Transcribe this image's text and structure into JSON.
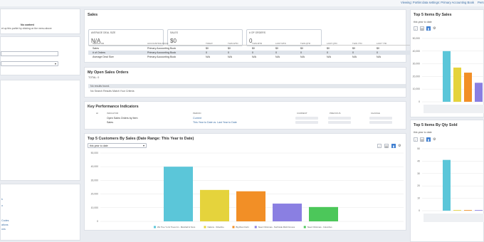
{
  "topbar": {
    "viewing": "Viewing: Portlet data settings: Primary Accounting Book",
    "user": "Pers"
  },
  "left": {
    "no_content": "No content",
    "no_content_hint": "et up this portlet by clicking on the menu above",
    "links": [
      "k",
      "o",
      "Codes",
      "ations",
      "ons"
    ]
  },
  "sales": {
    "title": "Sales",
    "kpis": [
      {
        "label": "AVERAGE DEAL SIZE",
        "value": "N/A"
      },
      {
        "label": "SALES",
        "value": "$0"
      },
      {
        "label": "# OF ORDERS",
        "value": "0"
      }
    ],
    "columns": [
      "INDICATOR",
      "ACCOUNTING BOOK",
      "TODAY",
      "THIS WTD",
      "THIS MTD",
      "LAST MTD",
      "THIS QTD",
      "LAST QTD",
      "THIS YTD",
      "LAST YTD"
    ],
    "rows": [
      [
        "Sales",
        "Primary Accounting Book",
        "$0",
        "$0",
        "$0",
        "$0",
        "$0",
        "$0",
        "$0",
        "$0"
      ],
      [
        "# of Orders",
        "Primary Accounting Book",
        "0",
        "0",
        "0",
        "0",
        "0",
        "0",
        "0",
        "0"
      ],
      [
        "Average Deal Size",
        "Primary Accounting Book",
        "N/A",
        "N/A",
        "N/A",
        "N/A",
        "N/A",
        "N/A",
        "N/A",
        "N/A"
      ]
    ]
  },
  "orders": {
    "title": "My Open Sales Orders",
    "total": "TOTAL: 0",
    "no_results": "No results found.",
    "no_match": "No Search Results Match Your Criteria"
  },
  "kpi": {
    "title": "Key Performance Indicators",
    "columns": [
      "HI",
      "INDICATOR",
      "PERIOD",
      "CURRENT",
      "PREVIOUS",
      "CHANGE"
    ],
    "rows": [
      [
        "Open Sales Orders by Item",
        "Current"
      ],
      [
        "Sales",
        "This Year to Date vs. Last Year to Date"
      ]
    ]
  },
  "customers": {
    "title": "Top 5 Customers By Sales (Date Range: This Year to Date)",
    "select": "this year to date"
  },
  "items_sales": {
    "title": "Top 5 Items By Sales",
    "select": "this year to date"
  },
  "items_qty": {
    "title": "Top 5 Items By Qty Sold",
    "select": "this year to date"
  },
  "icons": {
    "line": "line-chart-icon",
    "area": "area-chart-icon",
    "bar": "bar-chart-icon",
    "settings": "settings-icon"
  },
  "chart_data": [
    {
      "type": "bar",
      "title": "Top 5 Customers By Sales",
      "ylim": [
        0,
        50000
      ],
      "yticks": [
        "50,000",
        "40,000",
        "30,000",
        "20,000",
        "10,000",
        "0"
      ],
      "categories": [
        "Wu Tree Yu Gi Trees Inc - Marshall & Sons",
        "Nations - Silverline",
        "Big River Debt",
        "Steel Christmas - Northside Mobil Groves",
        "Steel Christmas - Columbus"
      ],
      "values": [
        40000,
        23000,
        22000,
        13000,
        10500
      ],
      "colors": [
        "#5bc6d9",
        "#e5d33c",
        "#f28f26",
        "#8a7fe2",
        "#4cc75a"
      ]
    },
    {
      "type": "bar",
      "title": "Top 5 Items By Sales",
      "ylim": [
        0,
        50000
      ],
      "yticks": [
        "50,000",
        "40,000",
        "30,000",
        "20,000",
        "10,000",
        "0"
      ],
      "values": [
        40000,
        27000,
        23000,
        15000,
        10000
      ],
      "colors": [
        "#5bc6d9",
        "#e5d33c",
        "#f28f26",
        "#8a7fe2",
        "#4cc75a"
      ]
    },
    {
      "type": "bar",
      "title": "Top 5 Items By Qty Sold",
      "ylim": [
        0,
        50
      ],
      "yticks": [
        "50",
        "40",
        "30",
        "20",
        "10",
        "0"
      ],
      "values": [
        41,
        0.5,
        0.5,
        0.5,
        0.5
      ],
      "colors": [
        "#5bc6d9",
        "#e5d33c",
        "#f28f26",
        "#8a7fe2",
        "#4cc75a"
      ]
    }
  ]
}
